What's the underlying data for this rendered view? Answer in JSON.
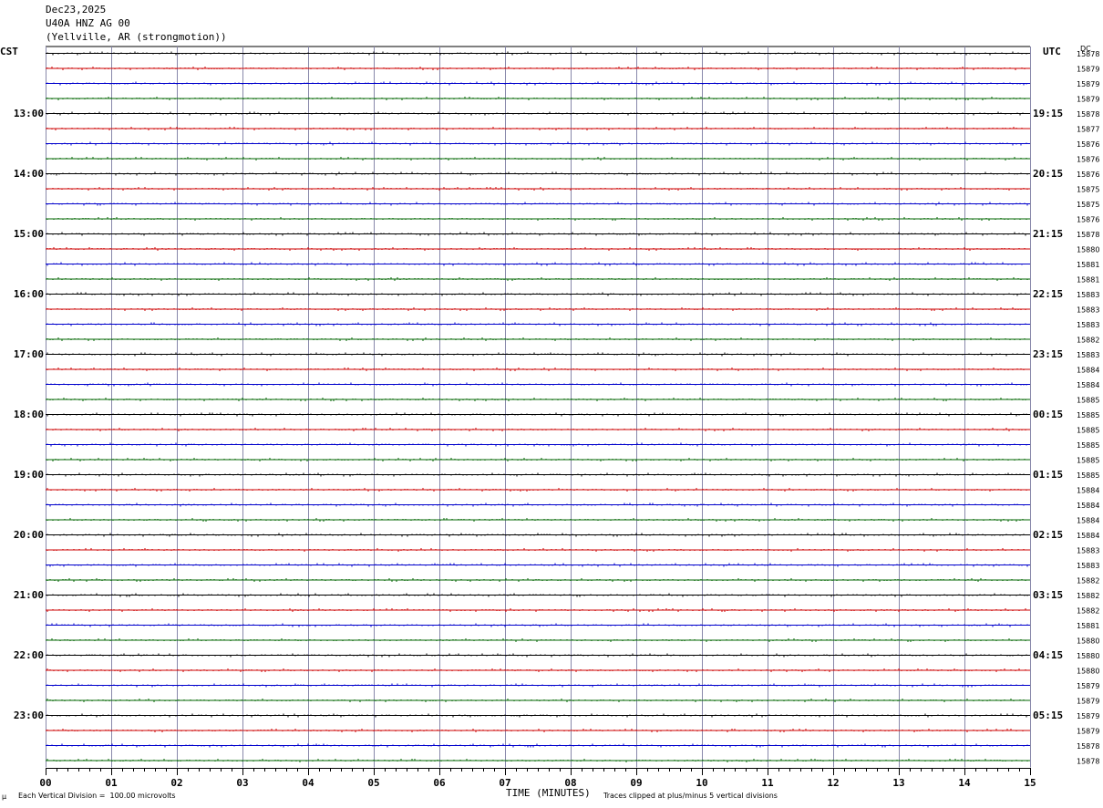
{
  "header": {
    "date": "Dec23,2025",
    "station": "U40A HNZ AG 00",
    "location": "(Yellville, AR (strongmotion))"
  },
  "left_zone_label": "CST",
  "right_zone_label": "UTC",
  "dc_label": "DC",
  "footer": {
    "left_mark": "μ",
    "scale_note": "Each Vertical Division =  100.00 microvolts",
    "clip_note": "Traces clipped at plus/minus 5 vertical divisions"
  },
  "chart_data": {
    "type": "line",
    "title": "",
    "xlabel": "TIME (MINUTES)",
    "ylabel": "",
    "xlim": [
      0,
      15
    ],
    "x_ticks": [
      "00",
      "01",
      "02",
      "03",
      "04",
      "05",
      "06",
      "07",
      "08",
      "09",
      "10",
      "11",
      "12",
      "13",
      "14",
      "15"
    ],
    "trace_colors": [
      "#000000",
      "#cc0000",
      "#0000cc",
      "#006600"
    ],
    "grid": true,
    "left_hour_labels": [
      "13:00",
      "14:00",
      "15:00",
      "16:00",
      "17:00",
      "18:00",
      "19:00",
      "20:00",
      "21:00",
      "22:00",
      "23:00"
    ],
    "right_hour_labels": [
      "19:15",
      "20:15",
      "21:15",
      "22:15",
      "23:15",
      "00:15",
      "01:15",
      "02:15",
      "03:15",
      "04:15",
      "05:15"
    ],
    "dc_offsets": [
      "15878",
      "15879",
      "15879",
      "15879",
      "15878",
      "15877",
      "15876",
      "15876",
      "15876",
      "15875",
      "15875",
      "15876",
      "15878",
      "15880",
      "15881",
      "15881",
      "15883",
      "15883",
      "15883",
      "15882",
      "15883",
      "15884",
      "15884",
      "15885",
      "15885",
      "15885",
      "15885",
      "15885",
      "15885",
      "15884",
      "15884",
      "15884",
      "15884",
      "15883",
      "15883",
      "15882",
      "15882",
      "15882",
      "15881",
      "15880",
      "15880",
      "15880",
      "15879",
      "15879",
      "15879",
      "15879",
      "15878",
      "15878"
    ]
  }
}
